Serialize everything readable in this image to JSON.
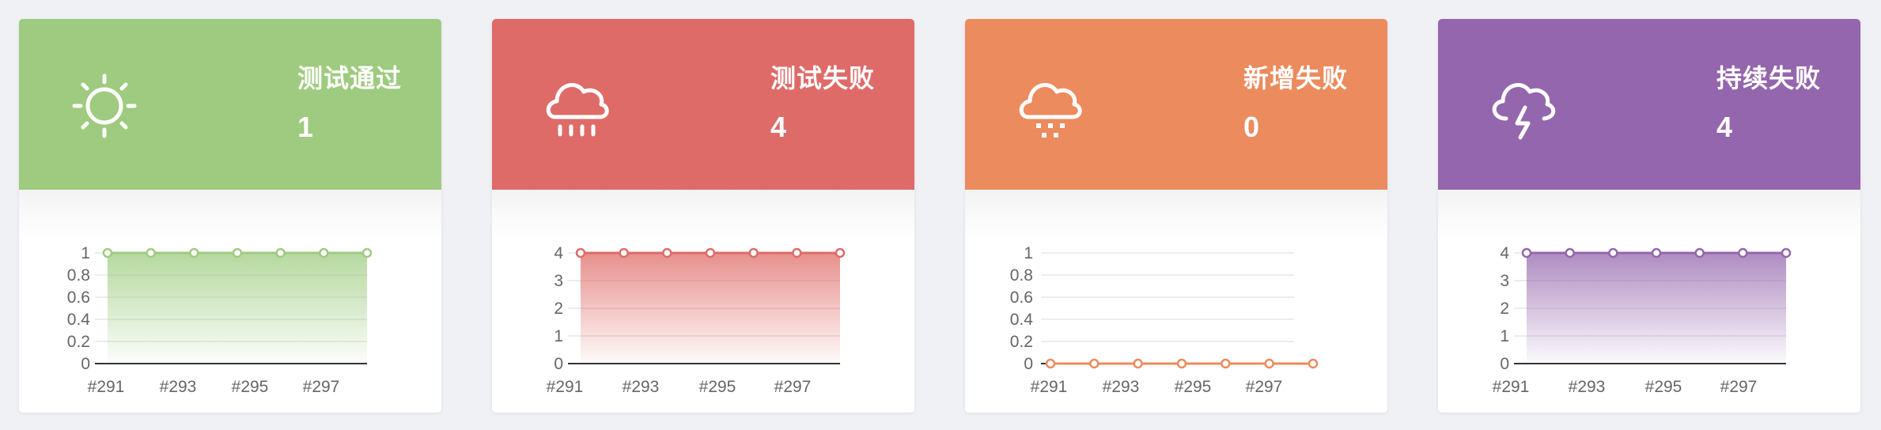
{
  "cards": [
    {
      "title": "测试通过",
      "count": "1",
      "icon": "sun-icon",
      "color": "#9ecb7f",
      "chart_data": {
        "type": "area",
        "x_ticks": [
          "#291",
          "#293",
          "#295",
          "#297"
        ],
        "y_ticks": [
          "1",
          "0.8",
          "0.6",
          "0.4",
          "0.2",
          "0"
        ],
        "ylim": [
          0,
          1
        ],
        "grid": true,
        "points_count": 7,
        "values": [
          1,
          1,
          1,
          1,
          1,
          1,
          1
        ]
      }
    },
    {
      "title": "测试失败",
      "count": "4",
      "icon": "rain-cloud-icon",
      "color": "#de6b68",
      "chart_data": {
        "type": "area",
        "x_ticks": [
          "#291",
          "#293",
          "#295",
          "#297"
        ],
        "y_ticks": [
          "4",
          "3",
          "2",
          "1",
          "0"
        ],
        "ylim": [
          0,
          4
        ],
        "grid": true,
        "points_count": 7,
        "values": [
          4,
          4,
          4,
          4,
          4,
          4,
          4
        ]
      }
    },
    {
      "title": "新增失败",
      "count": "0",
      "icon": "snow-cloud-icon",
      "color": "#ec8b5e",
      "chart_data": {
        "type": "area",
        "x_ticks": [
          "#291",
          "#293",
          "#295",
          "#297"
        ],
        "y_ticks": [
          "1",
          "0.8",
          "0.6",
          "0.4",
          "0.2",
          "0"
        ],
        "ylim": [
          0,
          1
        ],
        "grid": true,
        "points_count": 7,
        "values": [
          0,
          0,
          0,
          0,
          0,
          0,
          0
        ]
      }
    },
    {
      "title": "持续失败",
      "count": "4",
      "icon": "thunder-cloud-icon",
      "color": "#9466ad",
      "chart_data": {
        "type": "area",
        "x_ticks": [
          "#291",
          "#293",
          "#295",
          "#297"
        ],
        "y_ticks": [
          "4",
          "3",
          "2",
          "1",
          "0"
        ],
        "ylim": [
          0,
          4
        ],
        "grid": true,
        "points_count": 7,
        "values": [
          4,
          4,
          4,
          4,
          4,
          4,
          4
        ]
      }
    }
  ]
}
